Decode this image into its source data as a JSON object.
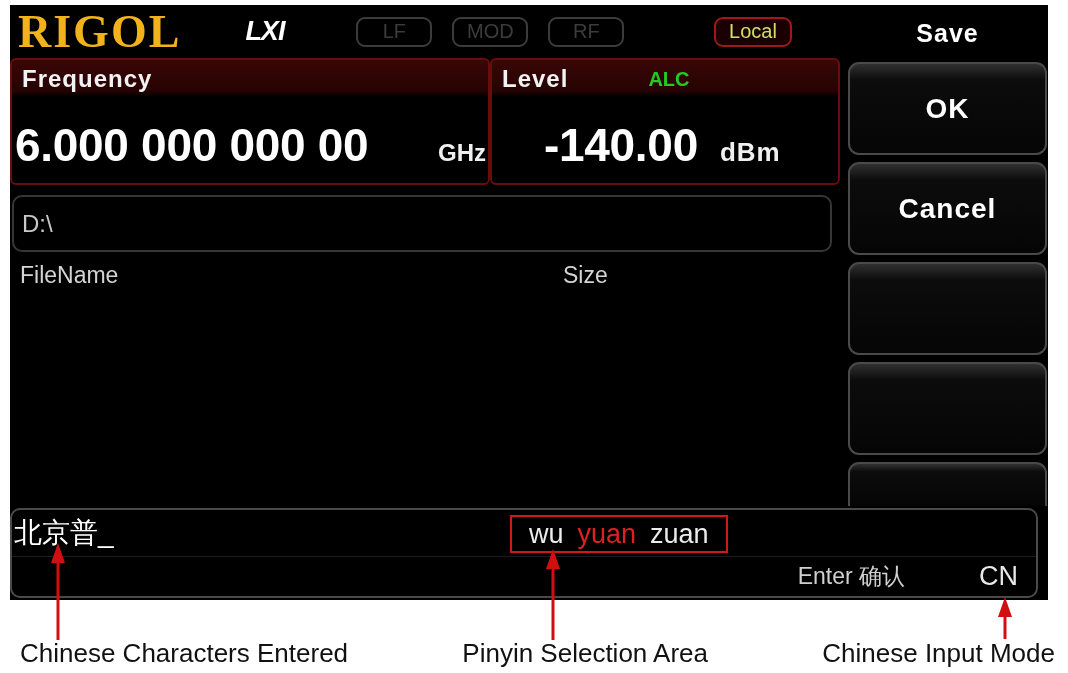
{
  "header": {
    "logo": "RIGOL",
    "lxi_logo": "LXI",
    "indicators": [
      {
        "label": "LF",
        "active": false
      },
      {
        "label": "MOD",
        "active": false
      },
      {
        "label": "RF",
        "active": false
      },
      {
        "label": "Local",
        "active": true
      }
    ]
  },
  "frequency": {
    "label": "Frequency",
    "value": "6.000 000 000 00",
    "unit": "GHz"
  },
  "level": {
    "label": "Level",
    "badge": "ALC",
    "value": "-140.00",
    "unit": "dBm"
  },
  "file_browser": {
    "path": "D:\\",
    "columns": [
      "FileName",
      "Size"
    ]
  },
  "menu": {
    "title": "Save",
    "softkeys": [
      {
        "kind": "label",
        "label": "OK"
      },
      {
        "kind": "label",
        "label": "Cancel"
      },
      {
        "kind": "blank"
      },
      {
        "kind": "blank"
      },
      {
        "kind": "blank"
      }
    ]
  },
  "input_bar": {
    "entered": "北京普_",
    "candidates": [
      {
        "text": "wu",
        "selected": false
      },
      {
        "text": "yuan",
        "selected": true
      },
      {
        "text": "zuan",
        "selected": false
      }
    ],
    "hint": "Enter 确认",
    "mode": "CN"
  },
  "annotations": [
    {
      "label": "Chinese Characters Entered"
    },
    {
      "label": "Pinyin Selection Area"
    },
    {
      "label": "Chinese Input Mode"
    }
  ]
}
